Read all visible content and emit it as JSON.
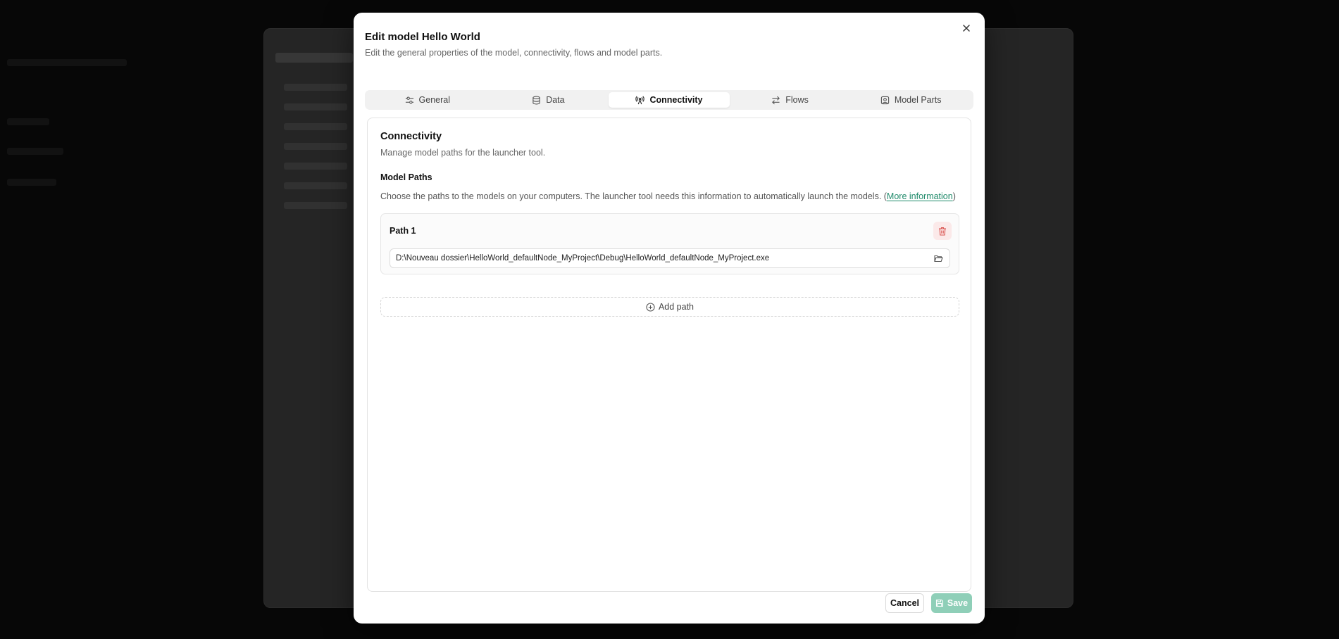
{
  "dialog": {
    "title": "Edit model Hello World",
    "description": "Edit the general properties of the model, connectivity, flows and model parts."
  },
  "tabs": [
    {
      "label": "General",
      "icon": "sliders-icon"
    },
    {
      "label": "Data",
      "icon": "database-icon"
    },
    {
      "label": "Connectivity",
      "icon": "antenna-icon",
      "active": true
    },
    {
      "label": "Flows",
      "icon": "arrows-swap-icon"
    },
    {
      "label": "Model Parts",
      "icon": "person-square-icon"
    }
  ],
  "connectivity": {
    "title": "Connectivity",
    "description": "Manage model paths for the launcher tool.",
    "section_title": "Model Paths",
    "section_desc": "Choose the paths to the models on your computers. The launcher tool needs this information to automatically launch the models. (",
    "more_info_label": "More information",
    "section_desc_end": ")",
    "paths": [
      {
        "label": "Path 1",
        "value": "D:\\Nouveau dossier\\HelloWorld_defaultNode_MyProject\\Debug\\HelloWorld_defaultNode_MyProject.exe"
      }
    ],
    "add_path_label": "Add path"
  },
  "footer": {
    "cancel_label": "Cancel",
    "save_label": "Save"
  },
  "colors": {
    "accent": "#1f8a6a",
    "save_disabled": "#8fcfb8",
    "delete_bg": "#fbe9e9",
    "delete_icon": "#d9534f"
  }
}
